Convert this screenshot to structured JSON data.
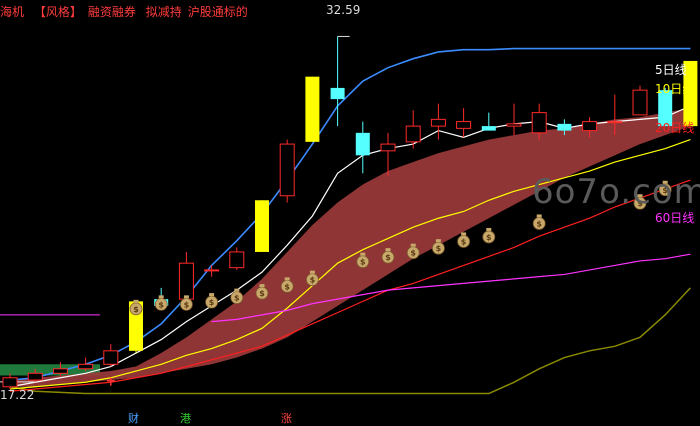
{
  "header": {
    "prefix": "海机",
    "tag": "【风格】",
    "items": [
      "融资融券",
      "拟减持",
      "沪股通标的"
    ]
  },
  "watermark": "6o7o.com",
  "price_labels": {
    "high": "32.59",
    "low": "17.22"
  },
  "legend": [
    {
      "label": "5日线",
      "color": "#ffffff"
    },
    {
      "label": "10日线",
      "color": "#ffff00"
    },
    {
      "label": "20日线",
      "color": "#ff2020"
    },
    {
      "label": "60日线",
      "color": "#ff33ff"
    }
  ],
  "bottom_tags": [
    {
      "label": "财",
      "color": "#4aa3ff"
    },
    {
      "label": "港",
      "color": "#33cc33"
    },
    {
      "label": "涨",
      "color": "#ff4444"
    }
  ],
  "colors": {
    "up": "#ff2a2a",
    "down": "#55ffff",
    "limit_up": "#ffff00",
    "band": "#9b3a3a",
    "upper_line": "#3a8cff",
    "olive": "#8a8a00"
  },
  "chart_data": {
    "type": "candlestick",
    "ylim": [
      16.5,
      33.5
    ],
    "candles": [
      {
        "o": 17.0,
        "h": 17.6,
        "l": 16.9,
        "c": 17.4,
        "k": "up"
      },
      {
        "o": 17.3,
        "h": 17.8,
        "l": 17.22,
        "c": 17.6,
        "k": "up"
      },
      {
        "o": 17.6,
        "h": 18.1,
        "l": 17.5,
        "c": 17.8,
        "k": "up"
      },
      {
        "o": 17.8,
        "h": 18.3,
        "l": 17.7,
        "c": 18.0,
        "k": "up"
      },
      {
        "o": 18.0,
        "h": 18.9,
        "l": 17.9,
        "c": 18.6,
        "k": "up"
      },
      {
        "o": 18.6,
        "h": 20.8,
        "l": 18.5,
        "c": 20.8,
        "k": "limit"
      },
      {
        "o": 20.6,
        "h": 21.4,
        "l": 20.4,
        "c": 20.9,
        "k": "down"
      },
      {
        "o": 20.9,
        "h": 23.0,
        "l": 20.8,
        "c": 22.5,
        "k": "up"
      },
      {
        "o": 22.2,
        "h": 22.4,
        "l": 21.9,
        "c": 22.2,
        "k": "up"
      },
      {
        "o": 22.3,
        "h": 23.2,
        "l": 22.2,
        "c": 23.0,
        "k": "up"
      },
      {
        "o": 23.0,
        "h": 25.3,
        "l": 23.0,
        "c": 25.3,
        "k": "limit"
      },
      {
        "o": 25.5,
        "h": 28.0,
        "l": 25.2,
        "c": 27.8,
        "k": "up"
      },
      {
        "o": 27.9,
        "h": 30.8,
        "l": 27.9,
        "c": 30.8,
        "k": "limit"
      },
      {
        "o": 30.3,
        "h": 32.59,
        "l": 28.6,
        "c": 29.8,
        "k": "down"
      },
      {
        "o": 28.3,
        "h": 28.8,
        "l": 26.5,
        "c": 27.3,
        "k": "down"
      },
      {
        "o": 27.5,
        "h": 28.3,
        "l": 26.4,
        "c": 27.8,
        "k": "up"
      },
      {
        "o": 27.9,
        "h": 29.3,
        "l": 27.6,
        "c": 28.6,
        "k": "up"
      },
      {
        "o": 28.6,
        "h": 29.6,
        "l": 28.0,
        "c": 28.9,
        "k": "up"
      },
      {
        "o": 28.8,
        "h": 29.4,
        "l": 28.1,
        "c": 28.5,
        "k": "up"
      },
      {
        "o": 28.6,
        "h": 29.2,
        "l": 28.4,
        "c": 28.4,
        "k": "down"
      },
      {
        "o": 28.6,
        "h": 29.6,
        "l": 28.2,
        "c": 28.7,
        "k": "up"
      },
      {
        "o": 28.3,
        "h": 29.6,
        "l": 28.0,
        "c": 29.2,
        "k": "up"
      },
      {
        "o": 28.7,
        "h": 28.9,
        "l": 28.2,
        "c": 28.4,
        "k": "down"
      },
      {
        "o": 28.4,
        "h": 29.0,
        "l": 28.1,
        "c": 28.8,
        "k": "up"
      },
      {
        "o": 28.8,
        "h": 30.0,
        "l": 28.2,
        "c": 28.8,
        "k": "up"
      },
      {
        "o": 29.1,
        "h": 30.4,
        "l": 29.1,
        "c": 30.2,
        "k": "up"
      },
      {
        "o": 30.2,
        "h": 30.3,
        "l": 28.6,
        "c": 28.6,
        "k": "down"
      },
      {
        "o": 28.6,
        "h": 31.5,
        "l": 28.6,
        "c": 31.5,
        "k": "limit"
      }
    ],
    "series": [
      {
        "name": "5日线",
        "color": "#ffffff",
        "values": [
          17.0,
          17.2,
          17.4,
          17.6,
          17.9,
          18.5,
          19.1,
          19.9,
          20.6,
          21.3,
          22.1,
          23.3,
          24.6,
          26.5,
          27.3,
          27.6,
          27.8,
          28.4,
          28.1,
          28.5,
          28.7,
          28.8,
          28.5,
          28.7,
          28.8,
          28.9,
          29.0,
          29.5
        ]
      },
      {
        "name": "10日线",
        "color": "#ffff00",
        "values": [
          16.9,
          17.0,
          17.1,
          17.2,
          17.4,
          17.7,
          18.0,
          18.4,
          18.7,
          19.1,
          19.6,
          20.5,
          21.5,
          22.5,
          23.1,
          23.6,
          24.1,
          24.5,
          24.8,
          25.3,
          25.7,
          26.0,
          26.3,
          26.6,
          27.0,
          27.3,
          27.6,
          28.0
        ]
      },
      {
        "name": "20日线",
        "color": "#ff2020",
        "values": [
          16.8,
          16.9,
          17.0,
          17.1,
          17.2,
          17.4,
          17.6,
          17.9,
          18.2,
          18.5,
          18.8,
          19.3,
          19.8,
          20.3,
          20.8,
          21.3,
          21.6,
          22.0,
          22.4,
          22.8,
          23.2,
          23.7,
          24.1,
          24.5,
          25.0,
          25.4,
          25.8,
          26.2
        ]
      },
      {
        "name": "60日线",
        "color": "#ff33ff",
        "values": [
          null,
          null,
          null,
          null,
          null,
          null,
          null,
          null,
          19.9,
          20.0,
          20.2,
          20.4,
          20.7,
          20.9,
          21.1,
          21.3,
          21.4,
          21.5,
          21.6,
          21.7,
          21.8,
          21.9,
          22.0,
          22.2,
          22.4,
          22.6,
          22.7,
          22.9
        ]
      }
    ],
    "upper_line": [
      17.3,
      17.4,
      17.7,
      18.0,
      18.4,
      19.0,
      19.8,
      21.0,
      22.4,
      23.5,
      24.7,
      26.2,
      27.8,
      29.5,
      30.6,
      31.2,
      31.6,
      31.9,
      32.0,
      32.0,
      32.05,
      32.05,
      32.05,
      32.05,
      32.05,
      32.05,
      32.05,
      32.05
    ],
    "band_upper": [
      17.3,
      17.4,
      17.5,
      17.6,
      17.7,
      17.9,
      18.5,
      19.2,
      20.0,
      20.8,
      21.8,
      23.0,
      24.2,
      25.2,
      26.0,
      26.6,
      27.0,
      27.4,
      27.7,
      28.0,
      28.2,
      28.4,
      28.5,
      28.7,
      28.9,
      29.0,
      29.2,
      29.4
    ],
    "band_lower": [
      17.0,
      17.0,
      17.1,
      17.2,
      17.3,
      17.4,
      17.6,
      17.8,
      18.0,
      18.3,
      18.7,
      19.2,
      19.9,
      20.6,
      21.3,
      22.0,
      22.7,
      23.3,
      23.9,
      24.5,
      25.1,
      25.7,
      26.3,
      26.8,
      27.3,
      27.8,
      28.2,
      28.6
    ],
    "money_markers": [
      20.2,
      20.4,
      20.4,
      20.5,
      20.7,
      20.9,
      21.2,
      21.5,
      null,
      22.3,
      22.5,
      22.7,
      22.9,
      23.2,
      23.4,
      null,
      24.0,
      null,
      null,
      null,
      24.9,
      25.5
    ],
    "olive_line": [
      17.0,
      16.8,
      16.75,
      16.7,
      16.7,
      16.7,
      16.7,
      16.7,
      16.7,
      16.7,
      16.7,
      16.7,
      16.7,
      16.7,
      16.7,
      16.7,
      16.7,
      16.7,
      16.7,
      16.7,
      17.2,
      17.8,
      18.3,
      18.6,
      18.8,
      19.2,
      20.2,
      21.4
    ],
    "pre_lines": {
      "green_band": [
        18.0,
        17.5
      ],
      "magenta_left": 20.2,
      "white_left": 18.2
    }
  }
}
